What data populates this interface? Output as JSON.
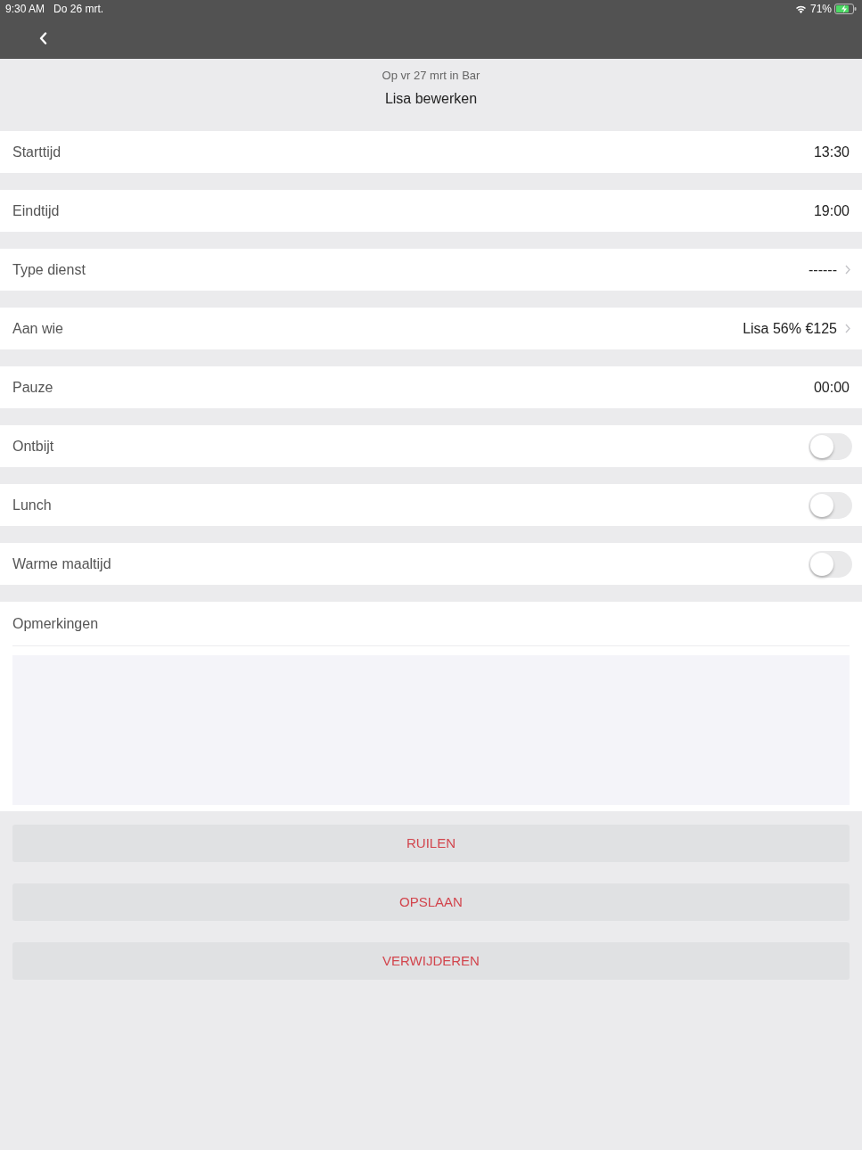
{
  "status_bar": {
    "time": "9:30 AM",
    "date": "Do 26 mrt.",
    "battery": "71%"
  },
  "header": {
    "subtitle": "Op vr 27 mrt in Bar",
    "title": "Lisa bewerken"
  },
  "fields": [
    {
      "kind": "value",
      "label": "Starttijd",
      "value": "13:30"
    },
    {
      "kind": "value",
      "label": "Eindtijd",
      "value": "19:00"
    },
    {
      "kind": "chevron",
      "label": "Type dienst",
      "value": "------"
    },
    {
      "kind": "chevron",
      "label": "Aan wie",
      "value": "Lisa 56% €125"
    },
    {
      "kind": "value",
      "label": "Pauze",
      "value": "00:00"
    },
    {
      "kind": "toggle",
      "label": "Ontbijt",
      "on": false
    },
    {
      "kind": "toggle",
      "label": "Lunch",
      "on": false
    },
    {
      "kind": "toggle",
      "label": "Warme maaltijd",
      "on": false
    }
  ],
  "remarks": {
    "label": "Opmerkingen"
  },
  "buttons": [
    "RUILEN",
    "OPSLAAN",
    "VERWIJDEREN"
  ]
}
